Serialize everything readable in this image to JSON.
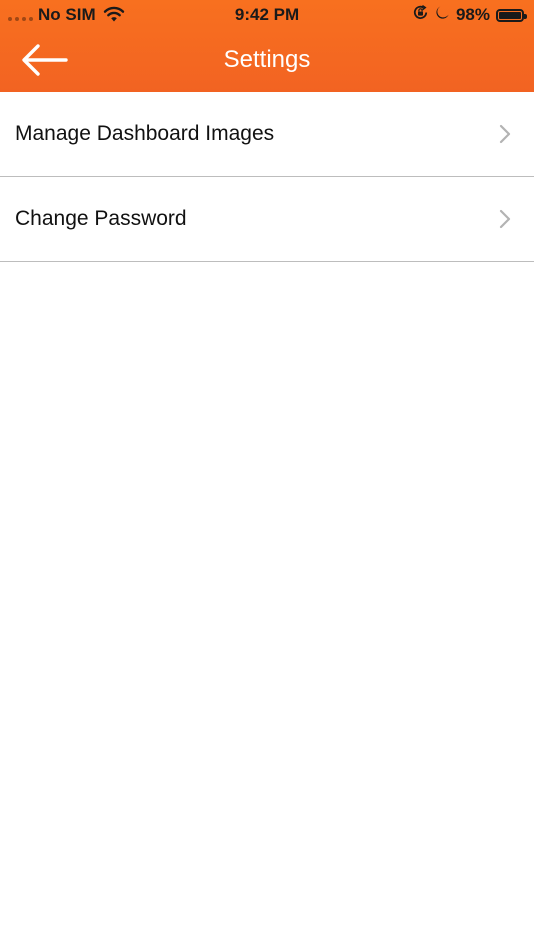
{
  "status_bar": {
    "carrier": "No SIM",
    "time": "9:42 PM",
    "battery_percent": "98%",
    "battery_level": 0.98,
    "icons": [
      "signal-dots-icon",
      "wifi-icon",
      "orientation-lock-icon",
      "moon-icon",
      "battery-icon"
    ]
  },
  "nav": {
    "title": "Settings",
    "back_icon": "arrow-left-icon"
  },
  "settings": {
    "items": [
      {
        "label": "Manage Dashboard Images",
        "icon": "chevron-right-icon"
      },
      {
        "label": "Change Password",
        "icon": "chevron-right-icon"
      }
    ]
  },
  "colors": {
    "header": "#f26322",
    "title_text": "#ffffff",
    "row_text": "#111111",
    "divider": "#bdbdbd",
    "chevron": "#b3b3b3"
  }
}
